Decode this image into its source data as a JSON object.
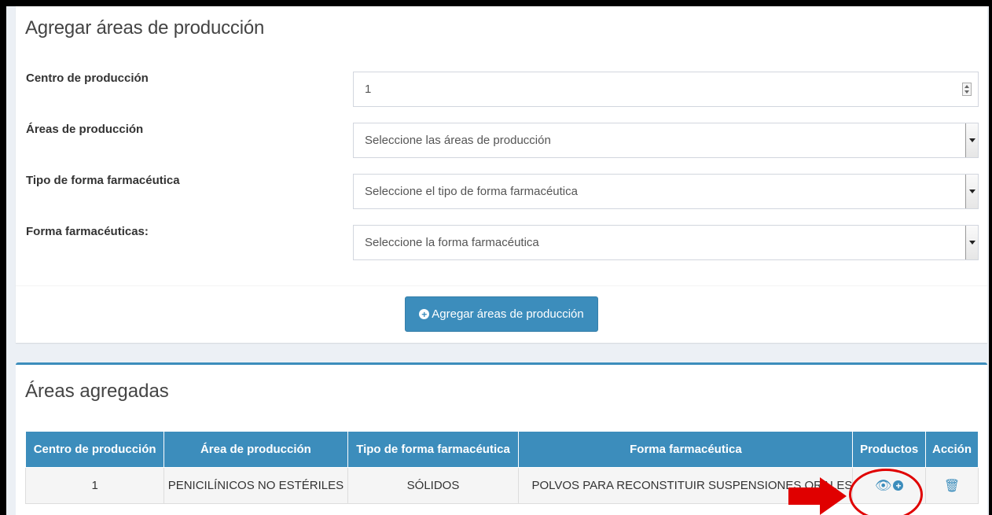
{
  "form": {
    "title": "Agregar áreas de producción",
    "fields": [
      {
        "label": "Centro de producción",
        "value": "1",
        "type": "number"
      },
      {
        "label": "Áreas de producción",
        "placeholder": "Seleccione las áreas de producción",
        "type": "select"
      },
      {
        "label": "Tipo de forma farmacéutica",
        "placeholder": "Seleccione el tipo de forma farmacéutica",
        "type": "select"
      },
      {
        "label": "Forma farmacéuticas:",
        "placeholder": "Seleccione la forma farmacéutica",
        "type": "select"
      }
    ],
    "submit_label": "Agregar áreas de producción"
  },
  "areas": {
    "title": "Áreas agregadas",
    "columns": [
      "Centro de producción",
      "Área de producción",
      "Tipo de forma farmacéutica",
      "Forma farmacéutica",
      "Productos",
      "Acción"
    ],
    "rows": [
      {
        "centro": "1",
        "area": "PENICILÍNICOS NO ESTÉRILES",
        "tipo": "SÓLIDOS",
        "forma": "POLVOS PARA RECONSTITUIR SUSPENSIONES ORALES",
        "productos_icons": [
          "eye-icon",
          "plus-circle-icon"
        ],
        "accion_icons": [
          "trash-icon"
        ]
      }
    ]
  },
  "colors": {
    "primary": "#3c8dbc",
    "annotation": "#e00000"
  }
}
